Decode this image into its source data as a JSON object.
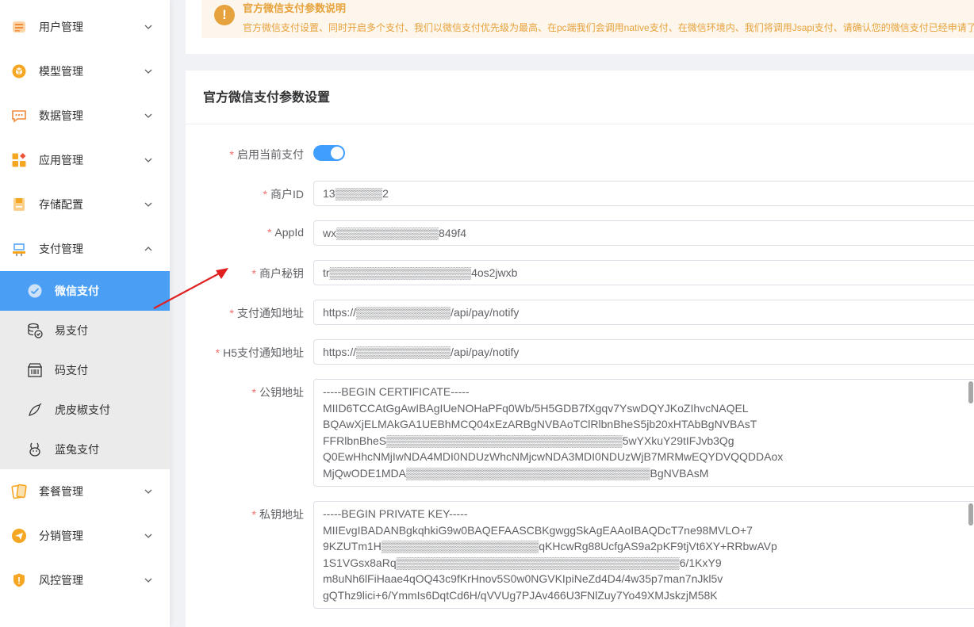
{
  "sidebar": {
    "menus": [
      {
        "label": "用户管理",
        "icon": "user-icon"
      },
      {
        "label": "模型管理",
        "icon": "cube-icon"
      },
      {
        "label": "数据管理",
        "icon": "chat-icon"
      },
      {
        "label": "应用管理",
        "icon": "apps-icon"
      },
      {
        "label": "存储配置",
        "icon": "storage-icon"
      },
      {
        "label": "支付管理",
        "icon": "payment-icon"
      },
      {
        "label": "套餐管理",
        "icon": "card-icon"
      },
      {
        "label": "分销管理",
        "icon": "send-icon"
      },
      {
        "label": "风控管理",
        "icon": "shield-icon"
      }
    ],
    "submenu": [
      {
        "label": "微信支付",
        "icon": "wechat-icon"
      },
      {
        "label": "易支付",
        "icon": "coins-icon"
      },
      {
        "label": "码支付",
        "icon": "qr-shop-icon"
      },
      {
        "label": "虎皮椒支付",
        "icon": "pepper-icon"
      },
      {
        "label": "蓝兔支付",
        "icon": "rabbit-icon"
      }
    ]
  },
  "alert": {
    "title": "官方微信支付参数说明",
    "desc": "官方微信支付设置、同时开启多个支付、我们以微信支付优先级为最高、在pc端我们会调用native支付、在微信环境内、我们将调用Jsapi支付、请确认您的微信支付已经申请了"
  },
  "form": {
    "title": "官方微信支付参数设置",
    "enable_label": "启用当前支付",
    "enabled": true,
    "fields": [
      {
        "label": "商户ID",
        "value": "13▒▒▒▒▒▒2"
      },
      {
        "label": "AppId",
        "value": "wx▒▒▒▒▒▒▒▒▒▒▒▒▒849f4"
      },
      {
        "label": "商户秘钥",
        "value": "tr▒▒▒▒▒▒▒▒▒▒▒▒▒▒▒▒▒▒4os2jwxb"
      },
      {
        "label": "支付通知地址",
        "value": "https://▒▒▒▒▒▒▒▒▒▒▒▒/api/pay/notify"
      },
      {
        "label": "H5支付通知地址",
        "value": "https://▒▒▒▒▒▒▒▒▒▒▒▒/api/pay/notify"
      }
    ],
    "cert_label": "公钥地址",
    "cert_value": "-----BEGIN CERTIFICATE-----\nMIID6TCCAtGgAwIBAgIUeNOHaPFq0Wb/5H5GDB7fXgqv7YswDQYJKoZIhvcNAQEL\nBQAwXjELMAkGA1UEBhMCQ04xEzARBgNVBAoTClRlbnBheS5jb20xHTAbBgNVBAsT\nFFRlbnBheS▒▒▒▒▒▒▒▒▒▒▒▒▒▒▒▒▒▒▒▒▒▒▒▒▒▒▒▒▒▒5wYXkuY29tIFJvb3Qg\nQ0EwHhcNMjIwNDA4MDI0NDUzWhcNMjcwNDA3MDI0NDUzWjB7MRMwEQYDVQQDDAox\nMjQwODE1MDA▒▒▒▒▒▒▒▒▒▒▒▒▒▒▒▒▒▒▒▒▒▒▒▒▒▒▒▒▒▒▒BgNVBAsM",
    "key_label": "私钥地址",
    "key_value": "-----BEGIN PRIVATE KEY-----\nMIIEvgIBADANBgkqhkiG9w0BAQEFAASCBKgwggSkAgEAAoIBAQDcT7ne98MVLO+7\n9KZUTm1H▒▒▒▒▒▒▒▒▒▒▒▒▒▒▒▒▒▒▒▒qKHcwRg88UcfgAS9a2pKF9tjVt6XY+RRbwAVp\n1S1VGsx8aRq▒▒▒▒▒▒▒▒▒▒▒▒▒▒▒▒▒▒▒▒▒▒▒▒▒▒▒▒▒▒▒▒▒▒▒▒6/1KxY9\nm8uNh6lFiHaae4qOQ43c9fKrHnov5S0w0NGVKIpiNeZd4D4/4w35p7man7nJkl5v\ngQThz9lici+6/YmmIs6DqtCd6H/qVVUg7PJAv466U3FNlZuy7Yo49XMJskzjM58K"
  }
}
